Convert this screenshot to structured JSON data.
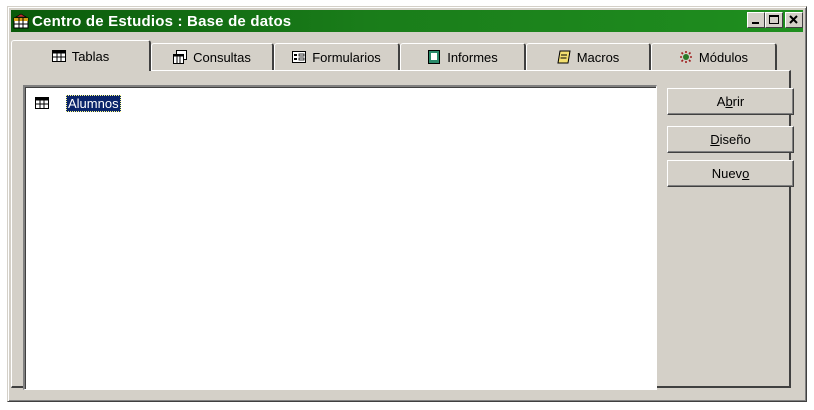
{
  "window": {
    "title": "Centro de Estudios : Base de datos",
    "title_bar_color": "#1a7d1a"
  },
  "tabs": [
    {
      "label": "Tablas",
      "icon": "table-icon",
      "active": true
    },
    {
      "label": "Consultas",
      "icon": "query-icon",
      "active": false
    },
    {
      "label": "Formularios",
      "icon": "form-icon",
      "active": false
    },
    {
      "label": "Informes",
      "icon": "report-icon",
      "active": false
    },
    {
      "label": "Macros",
      "icon": "macro-icon",
      "active": false
    },
    {
      "label": "Módulos",
      "icon": "module-icon",
      "active": false
    }
  ],
  "list": {
    "items": [
      {
        "label": "Alumnos",
        "icon": "table-icon",
        "selected": true
      }
    ]
  },
  "buttons": {
    "open": {
      "pre": "A",
      "key": "b",
      "post": "rir"
    },
    "design": {
      "pre": "",
      "key": "D",
      "post": "iseño"
    },
    "new": {
      "pre": "Nuev",
      "key": "o",
      "post": ""
    }
  }
}
